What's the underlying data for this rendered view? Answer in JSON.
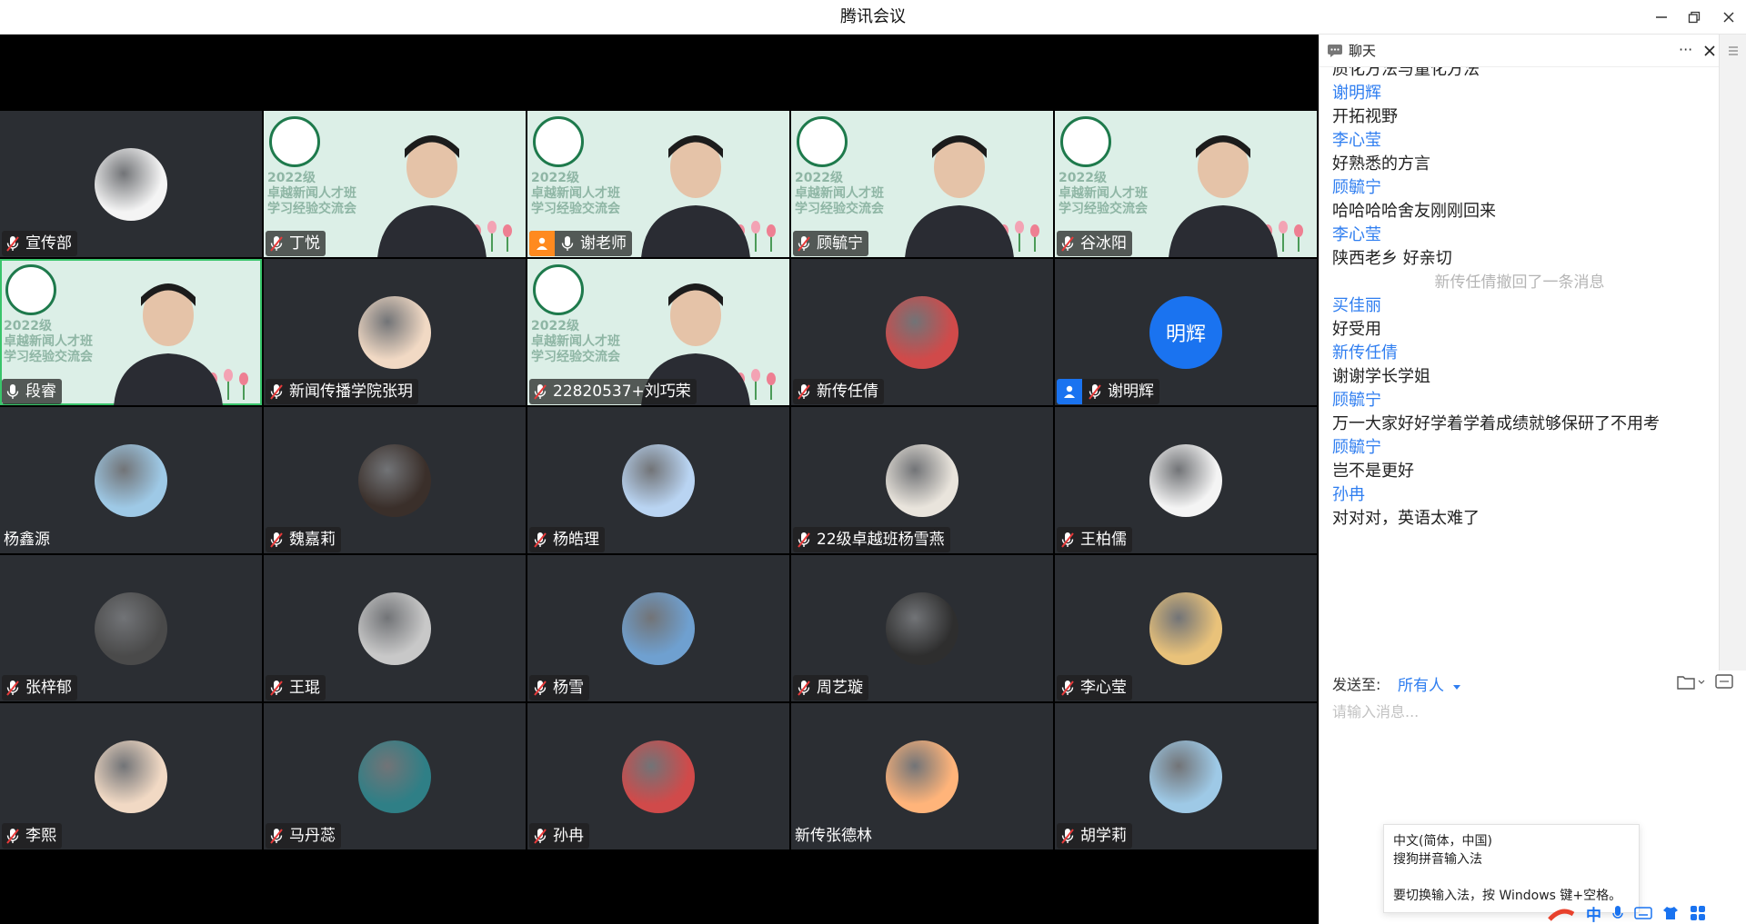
{
  "window": {
    "title": "腾讯会议",
    "controls": [
      "minimize-icon",
      "restore-icon",
      "close-icon"
    ]
  },
  "participants": [
    {
      "name": "宣传部",
      "muted": true,
      "video": false,
      "avatar": "panda-icon"
    },
    {
      "name": "丁悦",
      "muted": true,
      "video": true
    },
    {
      "name": "谢老师",
      "muted": false,
      "video": true,
      "host": true
    },
    {
      "name": "顾毓宁",
      "muted": true,
      "video": true
    },
    {
      "name": "谷冰阳",
      "muted": true,
      "video": true
    },
    {
      "name": "段睿",
      "muted": false,
      "video": true,
      "speaking": true
    },
    {
      "name": "新闻传播学院张玥",
      "muted": true,
      "video": false
    },
    {
      "name": "22820537+刘巧荣",
      "muted": true,
      "video": true
    },
    {
      "name": "新传任倩",
      "muted": true,
      "video": false
    },
    {
      "name": "谢明辉",
      "muted": true,
      "video": false,
      "avatar_text": "明辉",
      "cohost": true
    },
    {
      "name": "杨鑫源",
      "muted": false,
      "video": false,
      "noicon": true
    },
    {
      "name": "魏嘉莉",
      "muted": true,
      "video": false
    },
    {
      "name": "杨皓理",
      "muted": true,
      "video": false
    },
    {
      "name": "22级卓越班杨雪燕",
      "muted": true,
      "video": false
    },
    {
      "name": "王柏儒",
      "muted": true,
      "video": false
    },
    {
      "name": "张梓郁",
      "muted": true,
      "video": false
    },
    {
      "name": "王琨",
      "muted": true,
      "video": false
    },
    {
      "name": "杨雪",
      "muted": true,
      "video": false
    },
    {
      "name": "周艺璇",
      "muted": true,
      "video": false
    },
    {
      "name": "李心莹",
      "muted": true,
      "video": false
    },
    {
      "name": "李熙",
      "muted": true,
      "video": false
    },
    {
      "name": "马丹蕊",
      "muted": true,
      "video": false
    },
    {
      "name": "孙冉",
      "muted": true,
      "video": false
    },
    {
      "name": "新传张德林",
      "muted": false,
      "video": false,
      "noicon": true
    },
    {
      "name": "胡学莉",
      "muted": true,
      "video": false
    }
  ],
  "video_bg": {
    "line1": "2022级",
    "line2": "卓越新闻人才班",
    "line3": "学习经验交流会"
  },
  "chat": {
    "title": "聊天",
    "more_label": "···",
    "messages": [
      {
        "type": "text",
        "text": "质化方法与量化方法"
      },
      {
        "type": "sender",
        "text": "谢明辉"
      },
      {
        "type": "text",
        "text": "开拓视野"
      },
      {
        "type": "sender",
        "text": "李心莹"
      },
      {
        "type": "text",
        "text": "好熟悉的方言"
      },
      {
        "type": "sender",
        "text": "顾毓宁"
      },
      {
        "type": "text",
        "text": "哈哈哈哈舍友刚刚回来"
      },
      {
        "type": "sender",
        "text": "李心莹"
      },
      {
        "type": "text",
        "text": "陕西老乡 好亲切"
      },
      {
        "type": "system",
        "text": "新传任倩撤回了一条消息"
      },
      {
        "type": "sender",
        "text": "买佳丽"
      },
      {
        "type": "text",
        "text": "好受用"
      },
      {
        "type": "sender",
        "text": "新传任倩"
      },
      {
        "type": "text",
        "text": "谢谢学长学姐"
      },
      {
        "type": "sender",
        "text": "顾毓宁"
      },
      {
        "type": "text",
        "text": "万一大家好好学着学着成绩就够保研了不用考"
      },
      {
        "type": "sender",
        "text": "顾毓宁"
      },
      {
        "type": "text",
        "text": "岂不是更好"
      },
      {
        "type": "sender",
        "text": "孙冉"
      },
      {
        "type": "text",
        "text": "对对对，英语太难了"
      }
    ],
    "send_to_label": "发送至:",
    "send_to_value": "所有人",
    "input_placeholder": "请输入消息..."
  },
  "ime_tooltip": {
    "line1": "中文(简体，中国)",
    "line2": "搜狗拼音输入法",
    "line3": "要切换输入法，按 Windows 键+空格。"
  },
  "tray": {
    "ime_mode": "中"
  },
  "colors": {
    "tile_bg": "#2b2e33",
    "accent_blue": "#2f7ef0",
    "host_orange": "#ff8a1f",
    "speaking_green": "#39c56b"
  }
}
